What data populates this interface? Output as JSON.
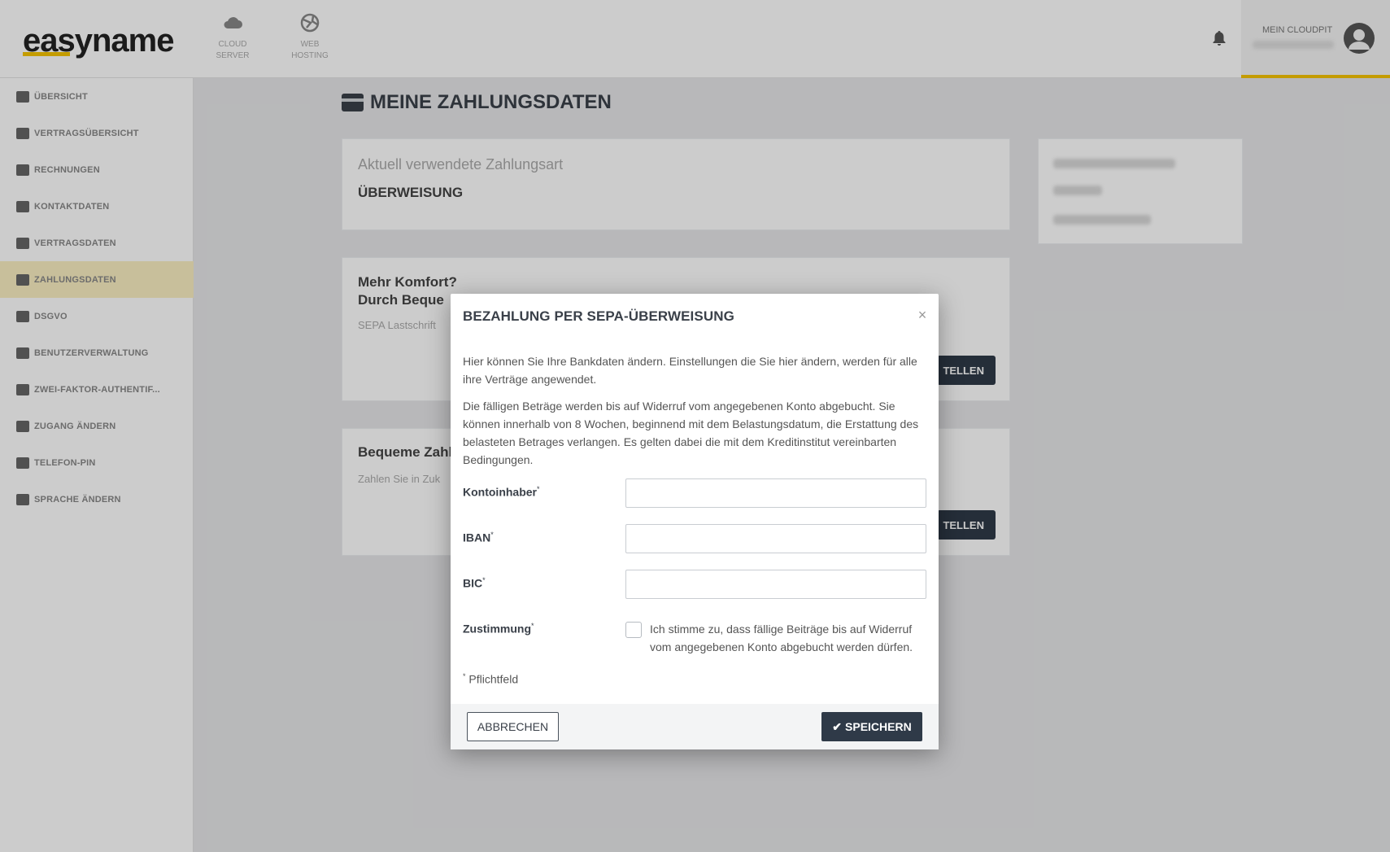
{
  "header": {
    "logo": "easyname",
    "nav": [
      {
        "label": "CLOUD\nSERVER",
        "icon": "cloud-icon"
      },
      {
        "label": "WEB\nHOSTING",
        "icon": "globe-icon"
      }
    ],
    "bell_icon": "bell-icon",
    "account_label": "MEIN CLOUDPIT",
    "avatar_icon": "user-avatar-icon"
  },
  "sidebar": {
    "items": [
      {
        "label": "ÜBERSICHT",
        "icon": "dashboard-icon"
      },
      {
        "label": "VERTRAGSÜBERSICHT",
        "icon": "contract-overview-icon"
      },
      {
        "label": "RECHNUNGEN",
        "icon": "invoice-icon"
      },
      {
        "label": "KONTAKTDATEN",
        "icon": "contact-icon"
      },
      {
        "label": "VERTRAGSDATEN",
        "icon": "contract-data-icon"
      },
      {
        "label": "ZAHLUNGSDATEN",
        "icon": "payment-card-icon"
      },
      {
        "label": "DSGVO",
        "icon": "handshake-icon"
      },
      {
        "label": "BENUTZERVERWALTUNG",
        "icon": "users-icon"
      },
      {
        "label": "ZWEI-FAKTOR-AUTHENTIF...",
        "icon": "user-lock-icon"
      },
      {
        "label": "ZUGANG ÄNDERN",
        "icon": "lock-icon"
      },
      {
        "label": "TELEFON-PIN",
        "icon": "phone-icon"
      },
      {
        "label": "SPRACHE ÄNDERN",
        "icon": "language-icon"
      }
    ],
    "active_index": 5
  },
  "main": {
    "title": "MEINE ZAHLUNGSDATEN",
    "current_card": {
      "label": "Aktuell verwendete Zahlungsart",
      "value": "ÜBERWEISUNG"
    },
    "comfort_card": {
      "title": "Mehr Komfort?\nDurch Beque",
      "text": "SEPA Lastschrift",
      "button": "TELLEN"
    },
    "easy_card": {
      "title": "Bequeme Zahl",
      "text": "Zahlen Sie in Zuk",
      "button": "TELLEN"
    }
  },
  "modal": {
    "title": "BEZAHLUNG PER SEPA-ÜBERWEISUNG",
    "close_symbol": "×",
    "paragraph1": "Hier können Sie Ihre Bankdaten ändern. Einstellungen die Sie hier ändern, werden für alle ihre Verträge angewendet.",
    "paragraph2": "Die fälligen Beträge werden bis auf Widerruf vom angegebenen Konto abgebucht. Sie können innerhalb von 8 Wochen, beginnend mit dem Belastungsdatum, die Erstattung des belasteten Betrages verlangen. Es gelten dabei die mit dem Kreditinstitut vereinbarten Bedingungen.",
    "fields": {
      "account_holder": {
        "label": "Kontoinhaber",
        "value": ""
      },
      "iban": {
        "label": "IBAN",
        "value": ""
      },
      "bic": {
        "label": "BIC",
        "value": ""
      }
    },
    "consent": {
      "label": "Zustimmung",
      "text": "Ich stimme zu, dass fällige Beiträge bis auf Widerruf vom angegebenen Konto abgebucht werden dürfen.",
      "checked": false
    },
    "required_marker": "*",
    "required_note": "Pflichtfeld",
    "cancel_label": "ABBRECHEN",
    "save_label": "SPEICHERN",
    "save_icon": "check-icon"
  }
}
